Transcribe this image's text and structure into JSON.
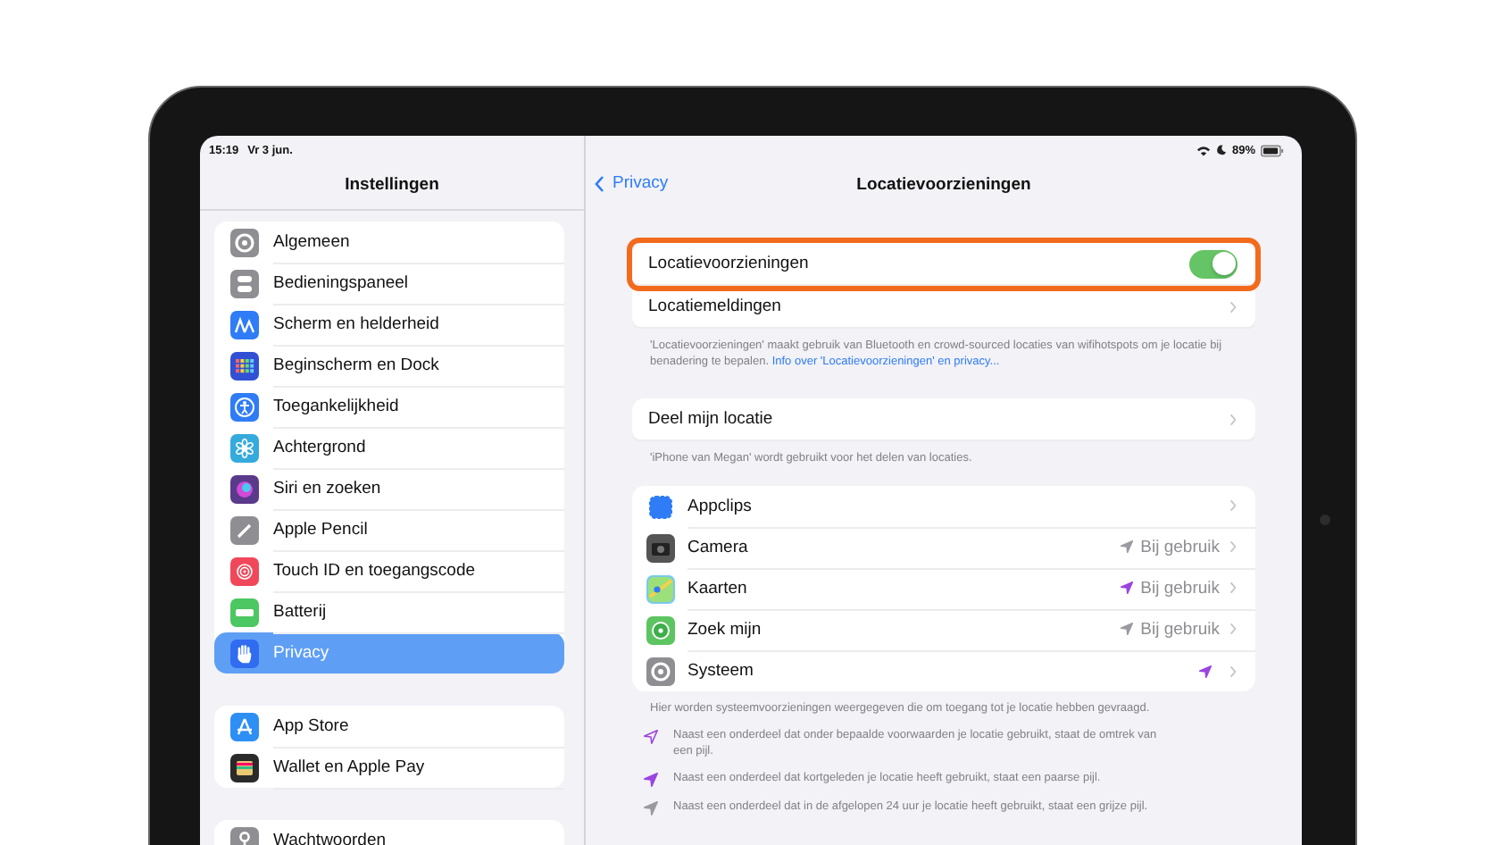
{
  "status_bar": {
    "time": "15:19",
    "date": "Vr 3 jun.",
    "battery": "89%"
  },
  "sidebar": {
    "title": "Instellingen",
    "groups": [
      [
        {
          "label": "Algemeen",
          "selected": false
        },
        {
          "label": "Bedieningspaneel",
          "selected": false
        },
        {
          "label": "Scherm en helderheid",
          "selected": false
        },
        {
          "label": "Beginscherm en Dock",
          "selected": false
        },
        {
          "label": "Toegankelijkheid",
          "selected": false
        },
        {
          "label": "Achtergrond",
          "selected": false
        },
        {
          "label": "Siri en zoeken",
          "selected": false
        },
        {
          "label": "Apple Pencil",
          "selected": false
        },
        {
          "label": "Touch ID en toegangscode",
          "selected": false
        },
        {
          "label": "Batterij",
          "selected": false
        },
        {
          "label": "Privacy",
          "selected": true
        }
      ],
      [
        {
          "label": "App Store",
          "selected": false
        },
        {
          "label": "Wallet en Apple Pay",
          "selected": false
        }
      ],
      [
        {
          "label": "Wachtwoorden",
          "selected": false
        }
      ]
    ]
  },
  "detail": {
    "back": "Privacy",
    "title": "Locatievoorzieningen",
    "location_group": {
      "rows": [
        {
          "kind": "toggle",
          "label": "Locatievoorzieningen",
          "on": true,
          "highlighted": true
        },
        {
          "kind": "link",
          "label": "Locatiemeldingen",
          "highlighted": false
        }
      ],
      "footer": "'Locatievoorzieningen' maakt gebruik van Bluetooth en crowd-sourced locaties van wifihotspots om je locatie bij benadering te bepalen.",
      "footer_link": "Info over 'Locatievoorzieningen' en privacy..."
    },
    "share": {
      "label": "Deel mijn locatie",
      "footer": "'iPhone van Megan' wordt gebruikt voor het delen van locaties."
    },
    "apps": [
      {
        "name": "Appclips",
        "arrow": false
      },
      {
        "name": "Camera",
        "arrow": true,
        "color": "#9a9aa0",
        "status": "Bij gebruik"
      },
      {
        "name": "Kaarten",
        "arrow": true,
        "color": "#9b44e0",
        "status": "Bij gebruik"
      },
      {
        "name": "Zoek mijn",
        "arrow": true,
        "color": "#9a9aa0",
        "status": "Bij gebruik"
      },
      {
        "name": "Systeem",
        "arrow": true,
        "color": "#9b44e0"
      }
    ],
    "apps_footer": "Hier worden systeemvoorzieningen weergegeven die om toegang tot je locatie hebben gevraagd.",
    "legend": [
      {
        "filled": false,
        "color": "#9b44e0",
        "text": "Naast een onderdeel dat onder bepaalde voorwaarden je locatie gebruikt, staat de omtrek van een pijl."
      },
      {
        "filled": true,
        "color": "#9b44e0",
        "text": "Naast een onderdeel dat kortgeleden je locatie heeft gebruikt, staat een paarse pijl."
      },
      {
        "filled": true,
        "color": "#9a9aa0",
        "text": "Naast een onderdeel dat in de afgelopen 24 uur je locatie heeft gebruikt, staat een grijze pijl."
      }
    ]
  }
}
